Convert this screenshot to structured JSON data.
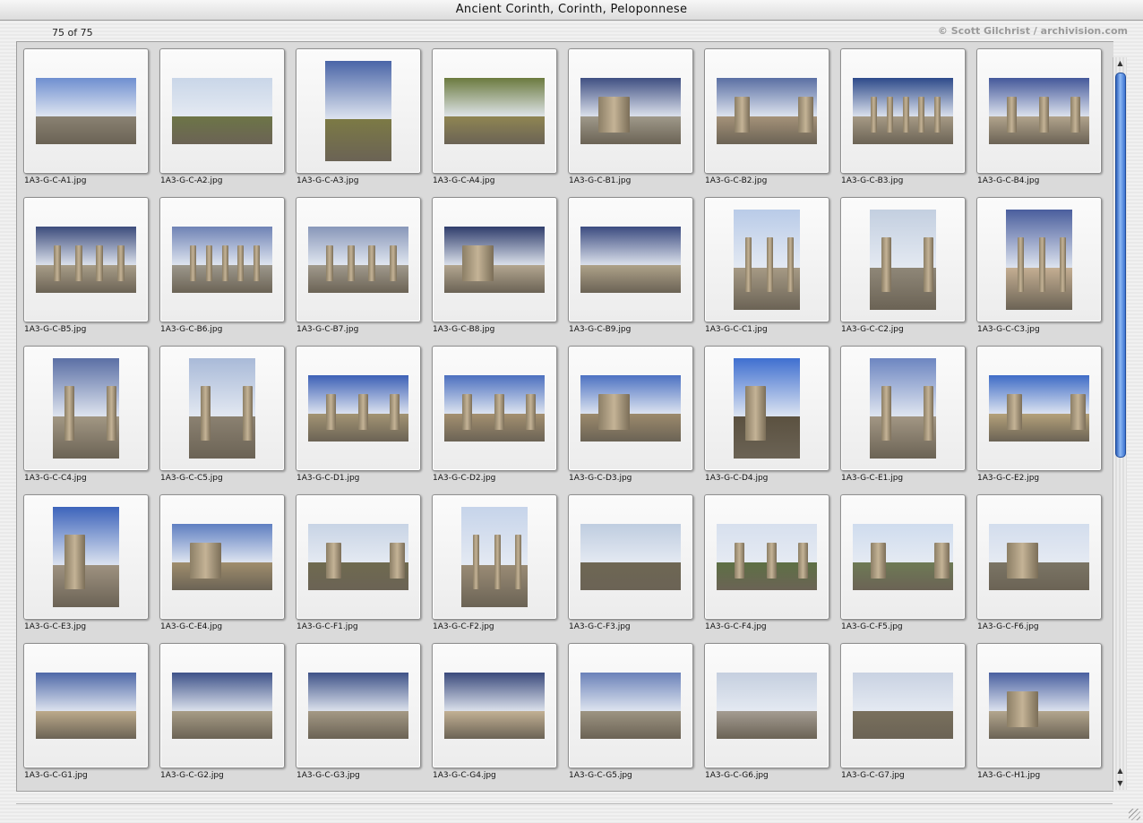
{
  "window": {
    "title": "Ancient Corinth, Corinth, Peloponnese"
  },
  "info": {
    "count": "75 of 75",
    "credit": "© Scott Gilchrist / archivision.com"
  },
  "thumbnails": [
    {
      "file": "1A3-G-C-A1.jpg",
      "orientation": "landscape",
      "sky": "#6f8fd0",
      "ground": "#8a8272",
      "columns": 0
    },
    {
      "file": "1A3-G-C-A2.jpg",
      "orientation": "landscape",
      "sky": "#c9d6e8",
      "ground": "#6d7547",
      "columns": 0
    },
    {
      "file": "1A3-G-C-A3.jpg",
      "orientation": "portrait",
      "sky": "#4a65a7",
      "ground": "#7c7a45",
      "columns": 0
    },
    {
      "file": "1A3-G-C-A4.jpg",
      "orientation": "landscape",
      "sky": "#6b7a3e",
      "ground": "#8f8552",
      "columns": 0
    },
    {
      "file": "1A3-G-C-B1.jpg",
      "orientation": "landscape",
      "sky": "#3f4f82",
      "ground": "#9f998a",
      "columns": 1
    },
    {
      "file": "1A3-G-C-B2.jpg",
      "orientation": "landscape",
      "sky": "#5a6fa3",
      "ground": "#a59279",
      "columns": 2
    },
    {
      "file": "1A3-G-C-B3.jpg",
      "orientation": "landscape",
      "sky": "#2d4a8a",
      "ground": "#a69a85",
      "columns": 5
    },
    {
      "file": "1A3-G-C-B4.jpg",
      "orientation": "landscape",
      "sky": "#44589a",
      "ground": "#b1a38c",
      "columns": 3
    },
    {
      "file": "1A3-G-C-B5.jpg",
      "orientation": "landscape",
      "sky": "#3c4c7c",
      "ground": "#a89d88",
      "columns": 4
    },
    {
      "file": "1A3-G-C-B6.jpg",
      "orientation": "landscape",
      "sky": "#6f83b5",
      "ground": "#9d988c",
      "columns": 5
    },
    {
      "file": "1A3-G-C-B7.jpg",
      "orientation": "landscape",
      "sky": "#8897b9",
      "ground": "#a19a8d",
      "columns": 4
    },
    {
      "file": "1A3-G-C-B8.jpg",
      "orientation": "landscape",
      "sky": "#2f3d6c",
      "ground": "#b3a690",
      "columns": 1
    },
    {
      "file": "1A3-G-C-B9.jpg",
      "orientation": "landscape",
      "sky": "#3b4b80",
      "ground": "#aea289",
      "columns": 0
    },
    {
      "file": "1A3-G-C-C1.jpg",
      "orientation": "portrait",
      "sky": "#b9cbe8",
      "ground": "#a69a85",
      "columns": 3
    },
    {
      "file": "1A3-G-C-C2.jpg",
      "orientation": "portrait",
      "sky": "#c3cfe0",
      "ground": "#8f8778",
      "columns": 2
    },
    {
      "file": "1A3-G-C-C3.jpg",
      "orientation": "portrait",
      "sky": "#4a5e9d",
      "ground": "#c4ae92",
      "columns": 3
    },
    {
      "file": "1A3-G-C-C4.jpg",
      "orientation": "portrait",
      "sky": "#5b6fa5",
      "ground": "#a29783",
      "columns": 2
    },
    {
      "file": "1A3-G-C-C5.jpg",
      "orientation": "portrait",
      "sky": "#a9bad8",
      "ground": "#8b8171",
      "columns": 2
    },
    {
      "file": "1A3-G-C-D1.jpg",
      "orientation": "landscape",
      "sky": "#3d61b6",
      "ground": "#a39473",
      "columns": 3
    },
    {
      "file": "1A3-G-C-D2.jpg",
      "orientation": "landscape",
      "sky": "#4c70bf",
      "ground": "#a49070",
      "columns": 3
    },
    {
      "file": "1A3-G-C-D3.jpg",
      "orientation": "landscape",
      "sky": "#4d72c2",
      "ground": "#9c8a6c",
      "columns": 1
    },
    {
      "file": "1A3-G-C-D4.jpg",
      "orientation": "portrait",
      "sky": "#3f6fd0",
      "ground": "#5b5140",
      "columns": 1
    },
    {
      "file": "1A3-G-C-E1.jpg",
      "orientation": "portrait",
      "sky": "#6d86c1",
      "ground": "#a29684",
      "columns": 2
    },
    {
      "file": "1A3-G-C-E2.jpg",
      "orientation": "landscape",
      "sky": "#3f6cc6",
      "ground": "#b4a17a",
      "columns": 2
    },
    {
      "file": "1A3-G-C-E3.jpg",
      "orientation": "portrait",
      "sky": "#3d64bb",
      "ground": "#9e9280",
      "columns": 1
    },
    {
      "file": "1A3-G-C-E4.jpg",
      "orientation": "landscape",
      "sky": "#5f7fc1",
      "ground": "#a08e6d",
      "columns": 1
    },
    {
      "file": "1A3-G-C-F1.jpg",
      "orientation": "landscape",
      "sky": "#c8d4e5",
      "ground": "#6f6a4f",
      "columns": 2
    },
    {
      "file": "1A3-G-C-F2.jpg",
      "orientation": "portrait",
      "sky": "#c6d4ea",
      "ground": "#9a8b75",
      "columns": 3
    },
    {
      "file": "1A3-G-C-F3.jpg",
      "orientation": "landscape",
      "sky": "#bfcde0",
      "ground": "#6e6754",
      "columns": 0
    },
    {
      "file": "1A3-G-C-F4.jpg",
      "orientation": "landscape",
      "sky": "#d7e0ee",
      "ground": "#5d7044",
      "columns": 3
    },
    {
      "file": "1A3-G-C-F5.jpg",
      "orientation": "landscape",
      "sky": "#cfdcee",
      "ground": "#6e7a55",
      "columns": 2
    },
    {
      "file": "1A3-G-C-F6.jpg",
      "orientation": "landscape",
      "sky": "#d3dded",
      "ground": "#7b7565",
      "columns": 1
    },
    {
      "file": "1A3-G-C-G1.jpg",
      "orientation": "landscape",
      "sky": "#4f69a8",
      "ground": "#bcaa8b",
      "columns": 0
    },
    {
      "file": "1A3-G-C-G2.jpg",
      "orientation": "landscape",
      "sky": "#3e5289",
      "ground": "#a79c86",
      "columns": 0
    },
    {
      "file": "1A3-G-C-G3.jpg",
      "orientation": "landscape",
      "sky": "#3f5388",
      "ground": "#a49985",
      "columns": 0
    },
    {
      "file": "1A3-G-C-G4.jpg",
      "orientation": "landscape",
      "sky": "#3a4a7c",
      "ground": "#c2b094",
      "columns": 0
    },
    {
      "file": "1A3-G-C-G5.jpg",
      "orientation": "landscape",
      "sky": "#6b82b9",
      "ground": "#9d9482",
      "columns": 0
    },
    {
      "file": "1A3-G-C-G6.jpg",
      "orientation": "landscape",
      "sky": "#c5cfdf",
      "ground": "#a49c92",
      "columns": 0
    },
    {
      "file": "1A3-G-C-G7.jpg",
      "orientation": "landscape",
      "sky": "#c9d2e2",
      "ground": "#79705d",
      "columns": 0
    },
    {
      "file": "1A3-G-C-H1.jpg",
      "orientation": "landscape",
      "sky": "#4a60a0",
      "ground": "#b3a68e",
      "columns": 1
    }
  ],
  "scrollbar": {
    "up_arrow": "▲",
    "down_arrow": "▼"
  }
}
